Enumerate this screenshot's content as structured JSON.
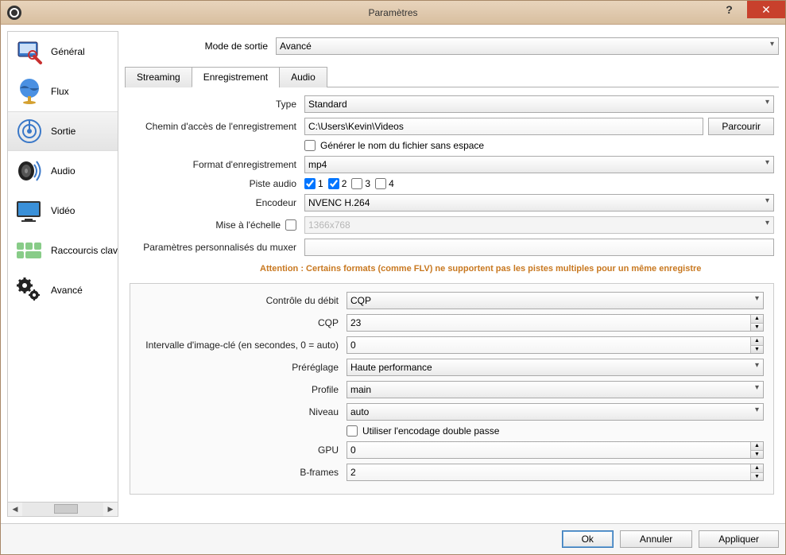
{
  "window": {
    "title": "Paramètres"
  },
  "sidebar": {
    "items": [
      {
        "label": "Général"
      },
      {
        "label": "Flux"
      },
      {
        "label": "Sortie"
      },
      {
        "label": "Audio"
      },
      {
        "label": "Vidéo"
      },
      {
        "label": "Raccourcis clavier"
      },
      {
        "label": "Avancé"
      }
    ]
  },
  "mode": {
    "label": "Mode de sortie",
    "value": "Avancé"
  },
  "tabs": {
    "streaming": "Streaming",
    "recording": "Enregistrement",
    "audio": "Audio"
  },
  "form": {
    "type_label": "Type",
    "type_value": "Standard",
    "path_label": "Chemin d'accès de l'enregistrement",
    "path_value": "C:\\Users\\Kevin\\Videos",
    "browse": "Parcourir",
    "gen_name_label": "Générer le nom du fichier sans espace",
    "format_label": "Format d'enregistrement",
    "format_value": "mp4",
    "track_label": "Piste audio",
    "t1": "1",
    "t2": "2",
    "t3": "3",
    "t4": "4",
    "encoder_label": "Encodeur",
    "encoder_value": "NVENC H.264",
    "rescale_label": "Mise à l'échelle",
    "rescale_value": "1366x768",
    "muxer_label": "Paramètres personnalisés du muxer",
    "muxer_value": "",
    "warning": "Attention : Certains formats (comme FLV) ne supportent pas les pistes multiples pour un même enregistre"
  },
  "encoder": {
    "rc_label": "Contrôle du débit",
    "rc_value": "CQP",
    "cqp_label": "CQP",
    "cqp_value": "23",
    "keyint_label": "Intervalle d'image-clé (en secondes, 0 = auto)",
    "keyint_value": "0",
    "preset_label": "Préréglage",
    "preset_value": "Haute performance",
    "profile_label": "Profile",
    "profile_value": "main",
    "level_label": "Niveau",
    "level_value": "auto",
    "twopass_label": "Utiliser l'encodage double passe",
    "gpu_label": "GPU",
    "gpu_value": "0",
    "bframes_label": "B-frames",
    "bframes_value": "2"
  },
  "footer": {
    "ok": "Ok",
    "cancel": "Annuler",
    "apply": "Appliquer"
  }
}
